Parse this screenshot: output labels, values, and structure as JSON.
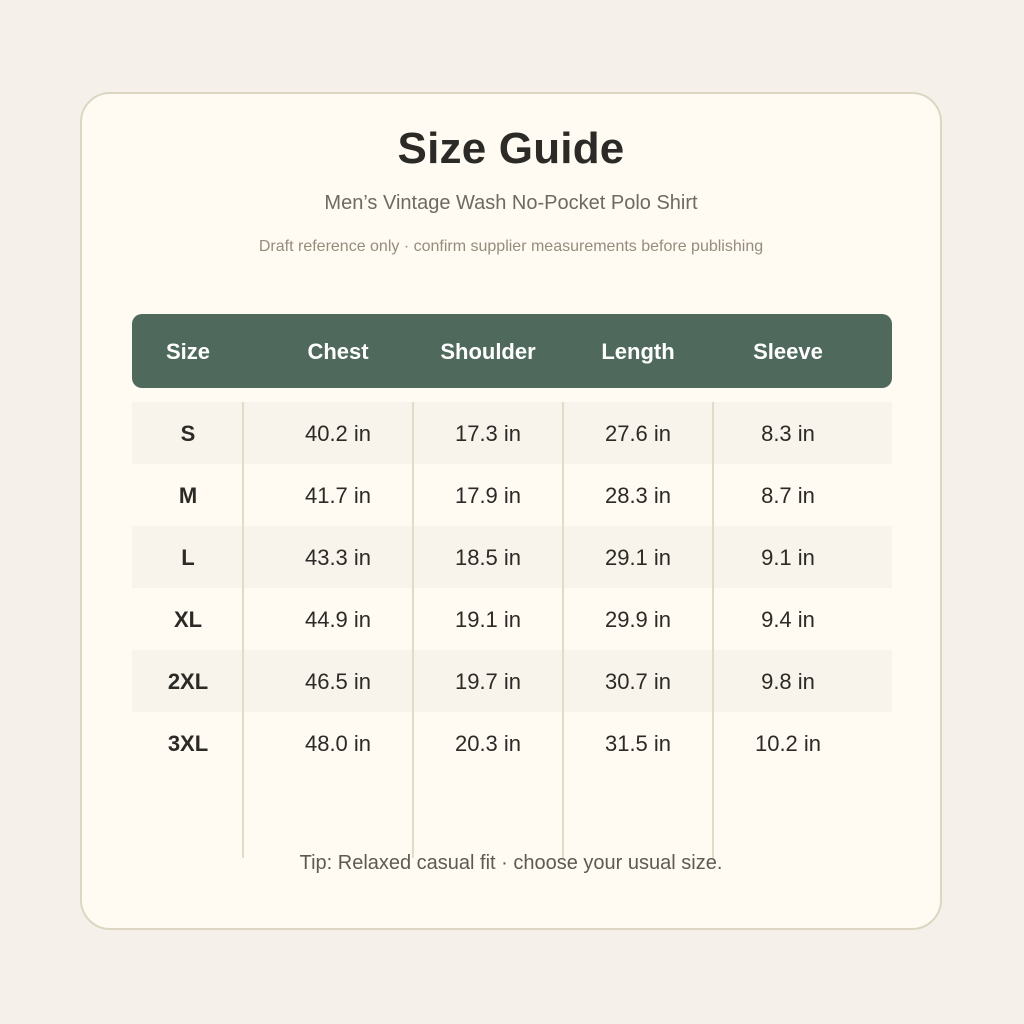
{
  "title": "Size Guide",
  "subtitle": "Men’s Vintage Wash No-Pocket Polo Shirt",
  "note": "Draft reference only · confirm supplier measurements before publishing",
  "table": {
    "headers": [
      "Size",
      "Chest",
      "Shoulder",
      "Length",
      "Sleeve"
    ],
    "rows": [
      [
        "S",
        "40.2 in",
        "17.3 in",
        "27.6 in",
        "8.3 in"
      ],
      [
        "M",
        "41.7 in",
        "17.9 in",
        "28.3 in",
        "8.7 in"
      ],
      [
        "L",
        "43.3 in",
        "18.5 in",
        "29.1 in",
        "9.1 in"
      ],
      [
        "XL",
        "44.9 in",
        "19.1 in",
        "29.9 in",
        "9.4 in"
      ],
      [
        "2XL",
        "46.5 in",
        "19.7 in",
        "30.7 in",
        "9.8 in"
      ],
      [
        "3XL",
        "48.0 in",
        "20.3 in",
        "31.5 in",
        "10.2 in"
      ]
    ]
  },
  "tip": "Tip: Relaxed casual fit · choose your usual size.",
  "colors": {
    "header_bg": "#4f6a5c",
    "card_bg": "#fffaf2",
    "page_bg": "#f5f1ea"
  }
}
